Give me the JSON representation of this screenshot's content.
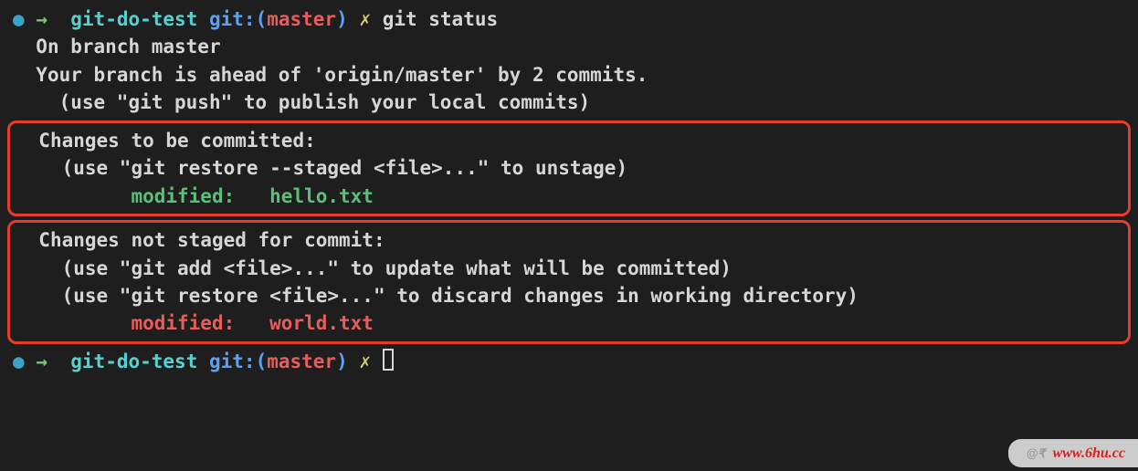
{
  "prompt1": {
    "bullet": "●",
    "arrow": "→",
    "dir": "git-do-test",
    "git_label": "git:(",
    "branch": "master",
    "git_close": ")",
    "dirty": "✗",
    "command": "git status"
  },
  "output": {
    "on_branch": "On branch master",
    "ahead": "Your branch is ahead of 'origin/master' by 2 commits.",
    "push_hint": "  (use \"git push\" to publish your local commits)"
  },
  "staged": {
    "header": "Changes to be committed:",
    "hint": "  (use \"git restore --staged <file>...\" to unstage)",
    "file_line": "        modified:   hello.txt"
  },
  "unstaged": {
    "header": "Changes not staged for commit:",
    "hint1": "  (use \"git add <file>...\" to update what will be committed)",
    "hint2": "  (use \"git restore <file>...\" to discard changes in working directory)",
    "file_line": "        modified:   world.txt"
  },
  "prompt2": {
    "bullet": "●",
    "arrow": "→",
    "dir": "git-do-test",
    "git_label": "git:(",
    "branch": "master",
    "git_close": ")",
    "dirty": "✗"
  },
  "watermark": {
    "at": "@₹",
    "text": "www.6hu.cc"
  }
}
